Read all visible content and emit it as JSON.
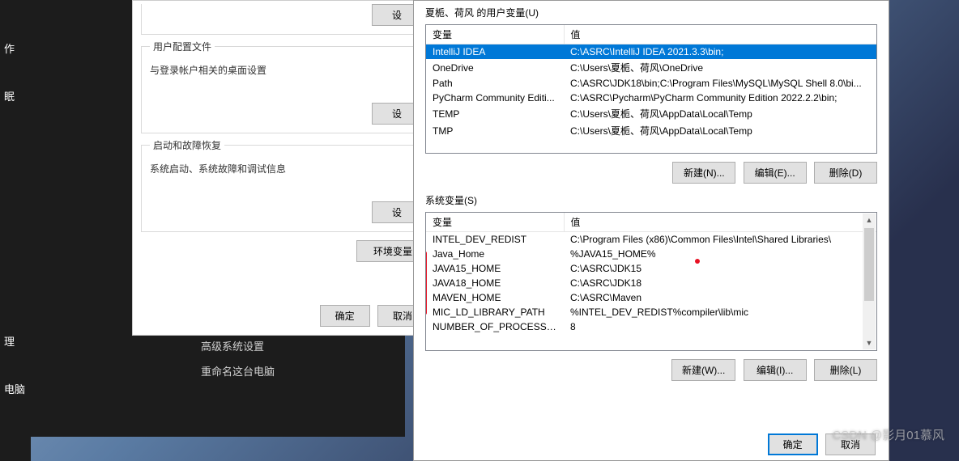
{
  "sidebar": {
    "items": [
      "作",
      "眠",
      "理",
      "电脑"
    ]
  },
  "inner": {
    "fs1": {
      "btn": "设"
    },
    "fs2": {
      "title": "用户配置文件",
      "desc": "与登录帐户相关的桌面设置",
      "btn": "设"
    },
    "fs3": {
      "title": "启动和故障恢复",
      "desc": "系统启动、系统故障和调试信息",
      "btn": "设"
    },
    "envbtn": "环境变量",
    "ok": "确定",
    "cancel": "取消"
  },
  "links": {
    "a": "高级系统设置",
    "b": "重命名这台电脑"
  },
  "env": {
    "usertitle": "夏栀、荷风 的用户变量(U)",
    "th_var": "变量",
    "th_val": "值",
    "user_rows": [
      {
        "k": "IntelliJ IDEA",
        "v": "C:\\ASRC\\IntelliJ IDEA 2021.3.3\\bin;",
        "sel": true
      },
      {
        "k": "OneDrive",
        "v": "C:\\Users\\夏栀、荷风\\OneDrive"
      },
      {
        "k": "Path",
        "v": "C:\\ASRC\\JDK18\\bin;C:\\Program Files\\MySQL\\MySQL Shell 8.0\\bi..."
      },
      {
        "k": "PyCharm Community Editi...",
        "v": "C:\\ASRC\\Pycharm\\PyCharm Community Edition 2022.2.2\\bin;"
      },
      {
        "k": "TEMP",
        "v": "C:\\Users\\夏栀、荷风\\AppData\\Local\\Temp"
      },
      {
        "k": "TMP",
        "v": "C:\\Users\\夏栀、荷风\\AppData\\Local\\Temp"
      }
    ],
    "btn_new_n": "新建(N)...",
    "btn_edit_e": "编辑(E)...",
    "btn_del_d": "删除(D)",
    "systitle": "系统变量(S)",
    "sys_rows": [
      {
        "k": "INTEL_DEV_REDIST",
        "v": "C:\\Program Files (x86)\\Common Files\\Intel\\Shared Libraries\\"
      },
      {
        "k": "Java_Home",
        "v": "%JAVA15_HOME%"
      },
      {
        "k": "JAVA15_HOME",
        "v": "C:\\ASRC\\JDK15"
      },
      {
        "k": "JAVA18_HOME",
        "v": "C:\\ASRC\\JDK18"
      },
      {
        "k": "MAVEN_HOME",
        "v": "C:\\ASRC\\Maven"
      },
      {
        "k": "MIC_LD_LIBRARY_PATH",
        "v": "%INTEL_DEV_REDIST%compiler\\lib\\mic"
      },
      {
        "k": "NUMBER_OF_PROCESSORS",
        "v": "8"
      }
    ],
    "btn_new_w": "新建(W)...",
    "btn_edit_i": "编辑(I)...",
    "btn_del_l": "删除(L)",
    "ok": "确定",
    "cancel": "取消"
  },
  "watermark": "CSDN @影月01慕风"
}
